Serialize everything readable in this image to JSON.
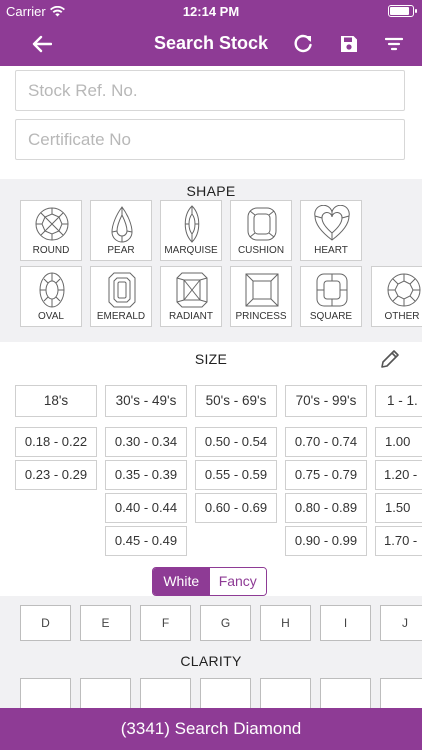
{
  "status": {
    "carrier": "Carrier",
    "time": "12:14 PM"
  },
  "nav": {
    "title": "Search Stock"
  },
  "inputs": {
    "stock_ref_placeholder": "Stock Ref. No.",
    "certificate_placeholder": "Certificate No"
  },
  "shape": {
    "label": "SHAPE",
    "items": [
      "ROUND",
      "PEAR",
      "MARQUISE",
      "CUSHION",
      "HEART",
      "OVAL",
      "EMERALD",
      "RADIANT",
      "PRINCESS",
      "SQUARE",
      "OTHER"
    ]
  },
  "size": {
    "label": "SIZE",
    "columns": [
      {
        "header": "18's",
        "values": [
          "0.18 - 0.22",
          "0.23 - 0.29"
        ]
      },
      {
        "header": "30's - 49's",
        "values": [
          "0.30 - 0.34",
          "0.35 - 0.39",
          "0.40 - 0.44",
          "0.45 - 0.49"
        ]
      },
      {
        "header": "50's - 69's",
        "values": [
          "0.50 - 0.54",
          "0.55 - 0.59",
          "0.60 - 0.69"
        ]
      },
      {
        "header": "70's - 99's",
        "values": [
          "0.70 - 0.74",
          "0.75 - 0.79",
          "0.80 - 0.89",
          "0.90 - 0.99"
        ]
      },
      {
        "header": "1 - 1.",
        "values": [
          "1.00",
          "1.20 -",
          "1.50",
          "1.70 -"
        ]
      }
    ]
  },
  "color_toggle": {
    "white": "White",
    "fancy": "Fancy",
    "selected": "White"
  },
  "colors": [
    "D",
    "E",
    "F",
    "G",
    "H",
    "I",
    "J"
  ],
  "clarity": {
    "label": "CLARITY"
  },
  "bottom": {
    "search_label": "(3341) Search Diamond"
  },
  "theme": {
    "accent": "#8e3b95",
    "section_bg": "#f1f1f3"
  }
}
